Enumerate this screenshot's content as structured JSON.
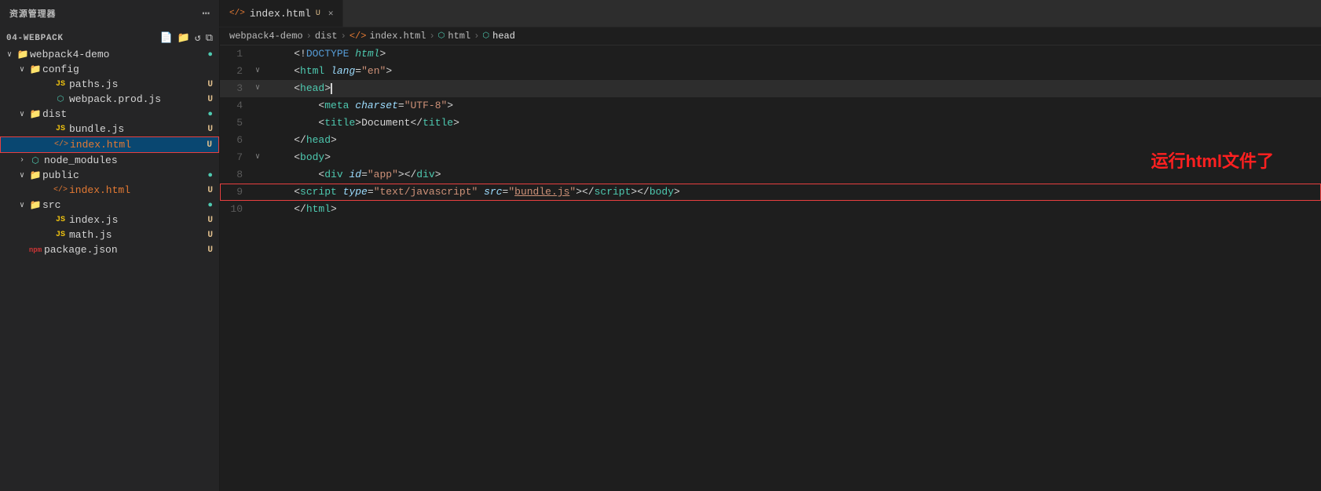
{
  "sidebar": {
    "header": "资源管理器",
    "more_icon": "⋯",
    "section_title": "04-WEBPACK",
    "icons": [
      "📄+",
      "📁+",
      "↺",
      "⧉"
    ],
    "tree": [
      {
        "id": "webpack4-demo",
        "label": "webpack4-demo",
        "type": "folder",
        "depth": 0,
        "expanded": true,
        "badge": "●",
        "badge_type": "dot-green"
      },
      {
        "id": "config",
        "label": "config",
        "type": "folder",
        "depth": 1,
        "expanded": true,
        "badge": "",
        "badge_type": ""
      },
      {
        "id": "paths.js",
        "label": "paths.js",
        "type": "js",
        "depth": 2,
        "badge": "U",
        "badge_type": "modified"
      },
      {
        "id": "webpack.prod.js",
        "label": "webpack.prod.js",
        "type": "js",
        "depth": 2,
        "badge": "U",
        "badge_type": "modified"
      },
      {
        "id": "dist",
        "label": "dist",
        "type": "folder",
        "depth": 1,
        "expanded": true,
        "badge": "●",
        "badge_type": "dot-green"
      },
      {
        "id": "bundle.js",
        "label": "bundle.js",
        "type": "js",
        "depth": 2,
        "badge": "U",
        "badge_type": "modified"
      },
      {
        "id": "index.html-dist",
        "label": "index.html",
        "type": "html",
        "depth": 2,
        "badge": "U",
        "badge_type": "modified",
        "active": true,
        "red_highlight": true
      },
      {
        "id": "node_modules",
        "label": "node_modules",
        "type": "module-folder",
        "depth": 1,
        "expanded": false,
        "badge": "",
        "badge_type": ""
      },
      {
        "id": "public",
        "label": "public",
        "type": "folder",
        "depth": 1,
        "expanded": true,
        "badge": "●",
        "badge_type": "dot-green"
      },
      {
        "id": "index.html-public",
        "label": "index.html",
        "type": "html",
        "depth": 2,
        "badge": "U",
        "badge_type": "modified"
      },
      {
        "id": "src",
        "label": "src",
        "type": "folder",
        "depth": 1,
        "expanded": true,
        "badge": "●",
        "badge_type": "dot-green"
      },
      {
        "id": "index.js",
        "label": "index.js",
        "type": "js",
        "depth": 2,
        "badge": "U",
        "badge_type": "modified"
      },
      {
        "id": "math.js",
        "label": "math.js",
        "type": "js",
        "depth": 2,
        "badge": "U",
        "badge_type": "modified"
      },
      {
        "id": "package.json",
        "label": "package.json",
        "type": "npm",
        "depth": 1,
        "badge": "U",
        "badge_type": "modified"
      }
    ]
  },
  "tab": {
    "icon": "</>",
    "filename": "index.html",
    "modified": "U"
  },
  "breadcrumb": {
    "parts": [
      "webpack4-demo",
      ">",
      "dist",
      ">",
      "</>",
      "index.html",
      ">",
      "⬡",
      "html",
      ">",
      "⬡",
      "head"
    ]
  },
  "annotation": "运行html文件了",
  "code": {
    "lines": [
      {
        "num": 1,
        "arrow": "",
        "indent": "    ",
        "content_html": "<!DOCTYPE <i class='c-doctype-text'>html</i>>"
      },
      {
        "num": 2,
        "arrow": "∨",
        "indent": "    ",
        "content_html": "<<span class='c-tag'>html</span> <span class='c-attr'>lang</span>=<span class='c-val'>\"en\"</span>>"
      },
      {
        "num": 3,
        "arrow": "∨",
        "indent": "    ",
        "content_html": "<<span class='c-tag'>head</span>><span class='c-cursor'></span>",
        "highlighted": true
      },
      {
        "num": 4,
        "arrow": "",
        "indent": "        ",
        "content_html": "<<span class='c-tag'>meta</span> <span class='c-attr'>charset</span>=<span class='c-val'>\"UTF-8\"</span>>"
      },
      {
        "num": 5,
        "arrow": "",
        "indent": "        ",
        "content_html": "<<span class='c-tag'>title</span>>Document</<span class='c-tag'>title</span>>"
      },
      {
        "num": 6,
        "arrow": "",
        "indent": "    ",
        "content_html": "</<span class='c-tag'>head</span>>"
      },
      {
        "num": 7,
        "arrow": "∨",
        "indent": "    ",
        "content_html": "<<span class='c-tag'>body</span>>"
      },
      {
        "num": 8,
        "arrow": "",
        "indent": "        ",
        "content_html": "<<span class='c-tag'>div</span> <span class='c-attr'>id</span>=<span class='c-val'>\"app\"</span>></<span class='c-tag'>div</span>>"
      },
      {
        "num": 9,
        "arrow": "",
        "indent": "    ",
        "content_html": "<<span class='c-tag'>script</span> <span class='c-attr'>type</span>=<span class='c-val'>\"text/javascript\"</span> <span class='c-attr'>src</span>=<span class='c-val'>\"<u>bundle.js</u>\"</span>></<span class='c-tag'>script</span>></<span class='c-tag'>body</span>>",
        "red_border": true
      },
      {
        "num": 10,
        "arrow": "",
        "indent": "    ",
        "content_html": "</<span class='c-tag'>html</span>>"
      }
    ]
  }
}
